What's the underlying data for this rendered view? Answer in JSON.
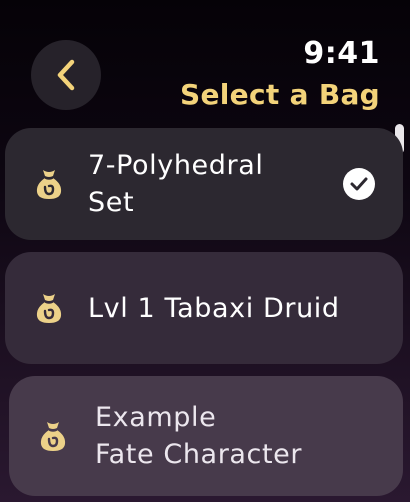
{
  "status": {
    "time": "9:41"
  },
  "header": {
    "title": "Select a Bag"
  },
  "bags": [
    {
      "label": "7-Polyhedral\nSet",
      "selected": true
    },
    {
      "label": "Lvl 1 Tabaxi Druid",
      "selected": false
    },
    {
      "label": "Example\nFate Character",
      "selected": false
    }
  ],
  "colors": {
    "accent": "#f3d37a",
    "icon": "#ecd189"
  }
}
